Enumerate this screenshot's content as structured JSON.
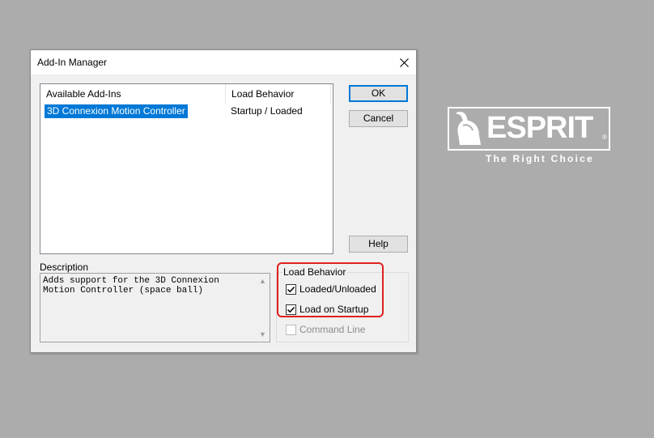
{
  "window": {
    "title": "Add-In Manager"
  },
  "addins_list": {
    "columns": [
      "Available Add-Ins",
      "Load Behavior"
    ],
    "rows": [
      {
        "name": "3D Connexion Motion Controller",
        "behavior": "Startup / Loaded",
        "selected": true
      }
    ]
  },
  "buttons": {
    "ok": "OK",
    "cancel": "Cancel",
    "help": "Help"
  },
  "description": {
    "label": "Description",
    "text": "Adds support for the 3D Connexion Motion Controller (space ball)"
  },
  "load_behavior": {
    "label": "Load Behavior",
    "options": [
      {
        "label": "Loaded/Unloaded",
        "checked": true,
        "enabled": true
      },
      {
        "label": "Load on Startup",
        "checked": true,
        "enabled": true
      },
      {
        "label": "Command Line",
        "checked": false,
        "enabled": false
      }
    ]
  },
  "logo": {
    "wordmark": "ESPRIT",
    "registered": "®",
    "tagline": "The Right Choice"
  },
  "colors": {
    "selection": "#0078d7",
    "highlight": "#e02020",
    "desktop": "#acacac"
  }
}
